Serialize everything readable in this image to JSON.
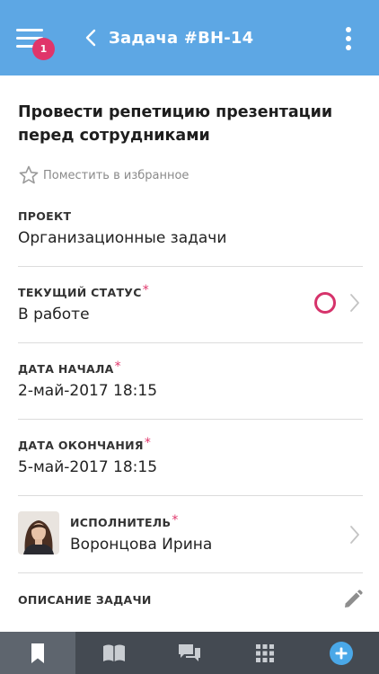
{
  "header": {
    "menu_badge": "1",
    "title": "Задача #ВН-14",
    "menu_icon": "hamburger-menu-icon",
    "back_icon": "chevron-left-icon",
    "more_icon": "more-vertical-icon"
  },
  "task": {
    "title": "Провести репетицию презентации перед сотрудниками",
    "favorite_label": "Поместить в избранное"
  },
  "fields": {
    "project": {
      "label": "ПРОЕКТ",
      "value": "Организационные задачи"
    },
    "status": {
      "label": "ТЕКУЩИЙ СТАТУС",
      "required": "*",
      "value": "В работе",
      "status_color": "#d6336b"
    },
    "start_date": {
      "label": "ДАТА НАЧАЛА",
      "required": "*",
      "value": "2-май-2017 18:15"
    },
    "end_date": {
      "label": "ДАТА ОКОНЧАНИЯ",
      "required": "*",
      "value": "5-май-2017 18:15"
    },
    "assignee": {
      "label": "ИСПОЛНИТЕЛЬ",
      "required": "*",
      "value": "Воронцова Ирина"
    },
    "description": {
      "label": "ОПИСАНИЕ ЗАДАЧИ"
    }
  },
  "tabbar": {
    "items": [
      {
        "icon": "bookmark-icon",
        "active": true
      },
      {
        "icon": "book-icon",
        "active": false
      },
      {
        "icon": "chat-icon",
        "active": false
      },
      {
        "icon": "grid-icon",
        "active": false
      },
      {
        "icon": "add-icon",
        "active": false
      }
    ]
  },
  "colors": {
    "header": "#5da7e4",
    "accent": "#e0356a",
    "tabbar": "#444a52",
    "add_button": "#4aa8e8"
  }
}
